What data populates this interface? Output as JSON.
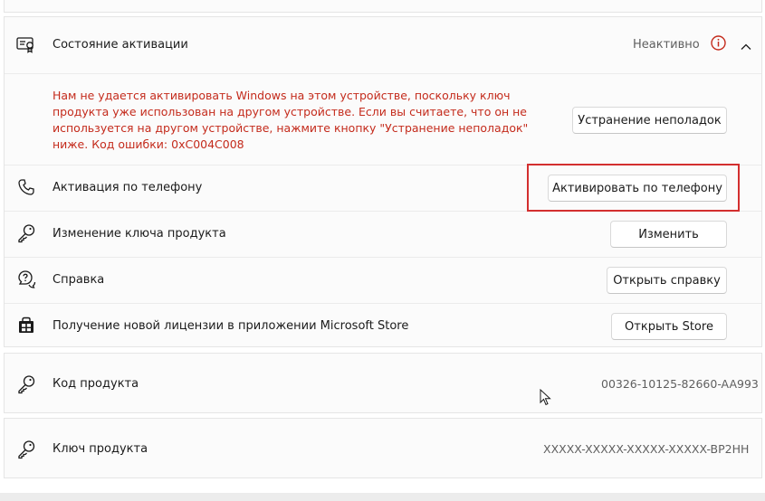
{
  "activation": {
    "title": "Состояние активации",
    "status": "Неактивно",
    "error_message": "Нам не удается активировать Windows на этом устройстве, поскольку ключ продукта уже использован на другом устройстве. Если вы считаете, что он не используется на другом устройстве, нажмите кнопку \"Устранение неполадок\" ниже. Код ошибки: 0xC004C008",
    "troubleshoot_button": "Устранение неполадок"
  },
  "options": [
    {
      "label": "Активация по телефону",
      "button": "Активировать по телефону",
      "icon": "phone-icon"
    },
    {
      "label": "Изменение ключа продукта",
      "button": "Изменить",
      "icon": "key-icon"
    },
    {
      "label": "Справка",
      "button": "Открыть справку",
      "icon": "help-chat-icon"
    },
    {
      "label": "Получение новой лицензии в приложении Microsoft Store",
      "button": "Открыть Store",
      "icon": "store-icon"
    }
  ],
  "product_id": {
    "label": "Код продукта",
    "value": "00326-10125-82660-AA993"
  },
  "product_key": {
    "label": "Ключ продукта",
    "value": "XXXXX-XXXXX-XXXXX-XXXXX-BP2HH"
  },
  "colors": {
    "error": "#c42b1c",
    "highlight": "#d32f2f"
  }
}
